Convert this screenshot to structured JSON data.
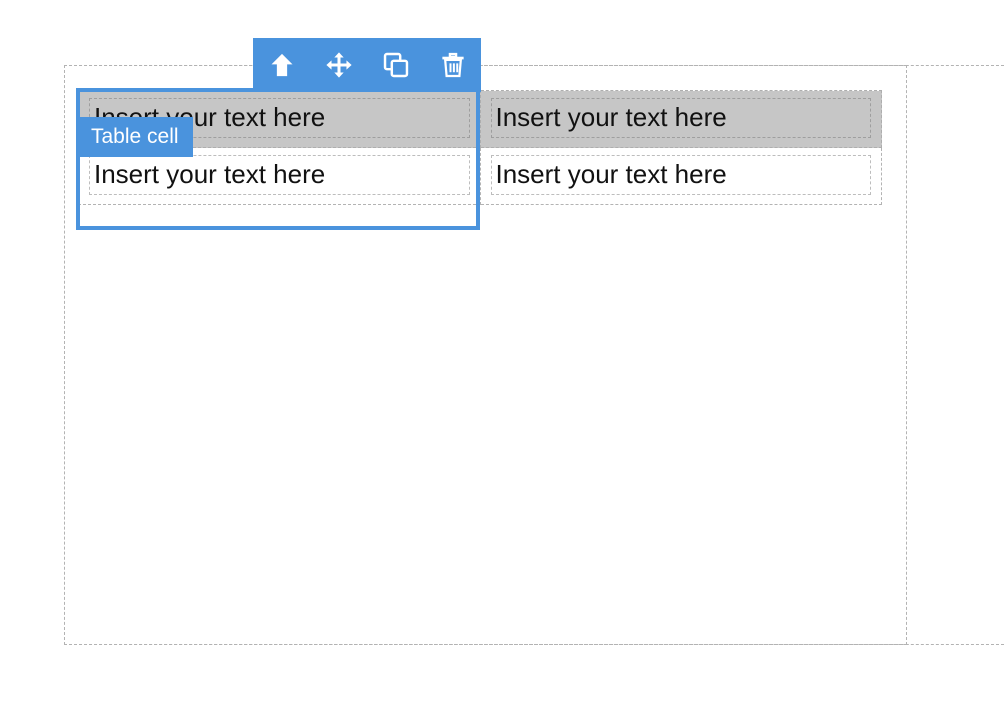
{
  "canvas": {
    "background": "#ffffff",
    "accent_blue": "#4a93dd",
    "selected_row_gray": "#c6c6c6",
    "dashed_border_gray": "#b3b3b3"
  },
  "toolbar": {
    "name": "table-cell-floating-toolbar",
    "background": "#4a93dd",
    "buttons": [
      {
        "id": "select-parent",
        "icon": "arrow-up-icon",
        "label": "Select parent"
      },
      {
        "id": "move",
        "icon": "move-arrows-icon",
        "label": "Move"
      },
      {
        "id": "duplicate",
        "icon": "copy-icon",
        "label": "Duplicate"
      },
      {
        "id": "delete",
        "icon": "trash-icon",
        "label": "Delete"
      }
    ]
  },
  "badge": {
    "label": "Table cell",
    "background": "#4a93dd",
    "color": "#ffffff"
  },
  "table": {
    "columns": 2,
    "selected_column_index": 0,
    "selected_row_index": 0,
    "rows": [
      {
        "selected": true,
        "cells": [
          {
            "text": "Insert your text here"
          },
          {
            "text": "Insert your text here"
          }
        ]
      },
      {
        "selected": false,
        "cells": [
          {
            "text": "Insert your text here"
          },
          {
            "text": "Insert your text here"
          }
        ]
      }
    ]
  }
}
